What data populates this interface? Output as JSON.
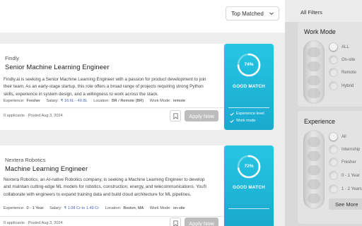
{
  "sort": {
    "selected": "Top Matched"
  },
  "jobs": [
    {
      "company": "Findly",
      "title": "Senior Machine Learning Engineer",
      "description": "Findly.ai is seeking a Senior Machine Learning Engineer with a passion for product development to join their team. As an early-stage startup, this role offers a broad range of projects requiring strong Python skills, experience in system design, and a willingness to work across the stack.",
      "experience_label": "Experience:",
      "experience": "Fresher",
      "salary_label": "Salary:",
      "salary": "₹ 16.6L - 49.8L",
      "location_label": "Location:",
      "location": "BR / Remote (BR)",
      "work_mode_label": "Work Mode:",
      "work_mode": "remote",
      "posted": "0 applicants · Posted Aug 3, 2024",
      "apply_label": "Apply Now",
      "match": {
        "percent": 74,
        "percent_text": "74%",
        "label": "GOOD MATCH",
        "criteria": [
          "Experience level",
          "Work mode"
        ]
      }
    },
    {
      "company": "Nextera Robotics",
      "title": "Machine Learning Engineer",
      "description": "Nextera Robotics, an AI-native Robotics company, is seeking a Machine Learning Engineer to develop and maintain cutting-edge ML models for robotics, construction, energy, and telecommunications. You'll collaborate with engineers to expand training data and build cloud architecture for ML pipelines.",
      "experience_label": "Experience:",
      "experience": "0 - 1 Year",
      "salary_label": "Salary:",
      "salary": "₹ 1.08 Cr to 1.49 Cr",
      "location_label": "Location:",
      "location": "Boston, MA",
      "work_mode_label": "Work Mode:",
      "work_mode": "on-site",
      "posted": "0 applicants · Posted Aug 3, 2024",
      "apply_label": "Apply Now",
      "match": {
        "percent": 72,
        "percent_text": "72%",
        "label": "GOOD MATCH"
      }
    }
  ],
  "filters": {
    "title": "All Filters",
    "work_mode": {
      "title": "Work Mode",
      "options": [
        "ALL",
        "On-site",
        "Remote",
        "Hybrid"
      ],
      "selected": "ALL"
    },
    "experience": {
      "title": "Experience",
      "options": [
        "All",
        "Internship",
        "Fresher",
        "0 - 1 Year",
        "1 - 2 Years"
      ],
      "selected": "All",
      "see_more_label": "See More"
    }
  },
  "colors": {
    "match_gradient_top": "#27c6e4",
    "match_gradient_bottom": "#1aa9cf",
    "salary_text": "#4a5fb0",
    "apply_button": "#bdbdbd"
  }
}
